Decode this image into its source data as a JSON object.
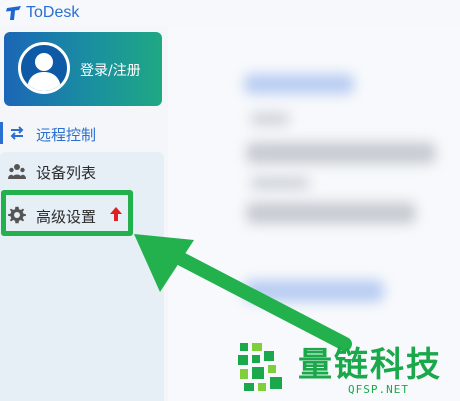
{
  "app": {
    "title": "ToDesk"
  },
  "user": {
    "login_label": "登录/注册"
  },
  "sidebar": {
    "items": [
      {
        "label": "远程控制",
        "icon": "swap-arrows-icon",
        "active": true
      },
      {
        "label": "设备列表",
        "icon": "people-icon"
      },
      {
        "label": "高级设置",
        "icon": "gear-icon",
        "badge_icon": "red-up-arrow-icon"
      }
    ]
  },
  "annotation": {
    "highlight_color": "#22b14c",
    "pointer_color": "#22b14c"
  },
  "watermark": {
    "text": "量链科技",
    "site": "QFSP.NET"
  },
  "colors": {
    "accent": "#2a6fd1",
    "card_start": "#1b66b7",
    "card_end": "#1fa884"
  }
}
